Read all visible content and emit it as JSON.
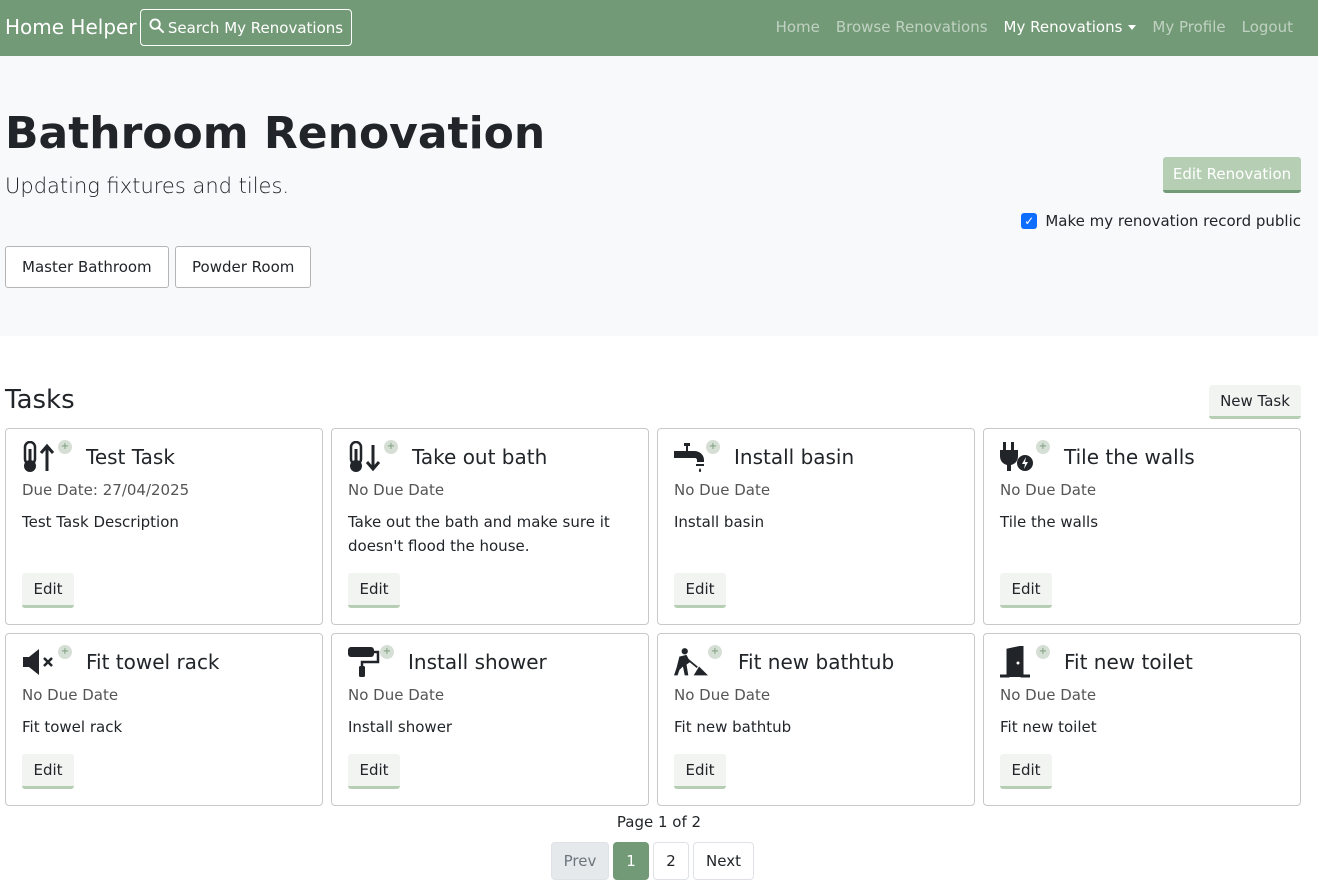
{
  "nav": {
    "brand": "Home Helper",
    "search_label": "Search My Renovations",
    "links": [
      "Home",
      "Browse Renovations",
      "My Renovations",
      "My Profile",
      "Logout"
    ]
  },
  "hero": {
    "title": "Bathroom Renovation",
    "subtitle": "Updating fixtures and tiles.",
    "rooms": [
      "Master Bathroom",
      "Powder Room"
    ],
    "edit_label": "Edit Renovation",
    "public_label": "Make my renovation record public",
    "public_checked": true
  },
  "tasks": {
    "heading": "Tasks",
    "new_task_label": "New Task",
    "edit_label": "Edit",
    "items": [
      {
        "title": "Test Task",
        "due": "Due Date: 27/04/2025",
        "desc": "Test Task Description",
        "icon": "thermometer-up-icon"
      },
      {
        "title": "Take out bath",
        "due": "No Due Date",
        "desc": "Take out the bath and make sure it doesn't flood the house.",
        "icon": "thermometer-down-icon"
      },
      {
        "title": "Install basin",
        "due": "No Due Date",
        "desc": "Install basin",
        "icon": "faucet-icon"
      },
      {
        "title": "Tile the walls",
        "due": "No Due Date",
        "desc": "Tile the walls",
        "icon": "plug-bolt-icon"
      },
      {
        "title": "Fit towel rack",
        "due": "No Due Date",
        "desc": "Fit towel rack",
        "icon": "speaker-mute-icon"
      },
      {
        "title": "Install shower",
        "due": "No Due Date",
        "desc": "Install shower",
        "icon": "paint-roller-icon"
      },
      {
        "title": "Fit new bathtub",
        "due": "No Due Date",
        "desc": "Fit new bathtub",
        "icon": "person-digging-icon"
      },
      {
        "title": "Fit new toilet",
        "due": "No Due Date",
        "desc": "Fit new toilet",
        "icon": "door-open-icon"
      }
    ]
  },
  "pagination": {
    "info": "Page 1 of 2",
    "prev": "Prev",
    "pages": [
      "1",
      "2"
    ],
    "current": "1",
    "next": "Next"
  },
  "colors": {
    "navbar": "#739a77",
    "accent_light": "#b6cfb4",
    "hero_bg": "#f8f9fa",
    "checkbox": "#0d6efd"
  }
}
